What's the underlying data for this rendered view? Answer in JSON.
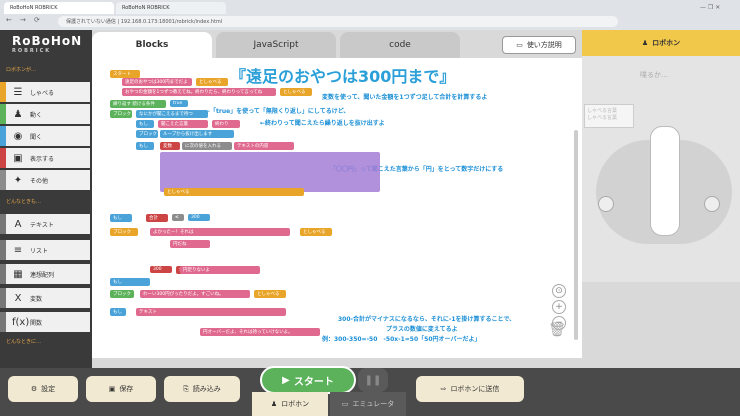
{
  "browser": {
    "tabs": [
      "RoBoHoN ROBRICK",
      "RoBoHoN ROBRICK"
    ],
    "url": "保護されていない通信 | 192.168.0.173:18001/robrick/index.html"
  },
  "app": {
    "logo": "RoBoHoN",
    "logo_sub": "ROBRICK"
  },
  "sidebar": {
    "section1": "ロボホンが…",
    "items": [
      {
        "label": "しゃべる",
        "icon": "speech-icon"
      },
      {
        "label": "動く",
        "icon": "robot-icon"
      },
      {
        "label": "聞く",
        "icon": "ear-icon"
      },
      {
        "label": "表示する",
        "icon": "display-icon"
      },
      {
        "label": "その他",
        "icon": "other-icon"
      }
    ],
    "section2": "どんなときも…",
    "items2": [
      {
        "label": "テキスト",
        "icon": "text-icon",
        "glyph": "A"
      },
      {
        "label": "リスト",
        "icon": "list-icon",
        "glyph": "≡"
      },
      {
        "label": "連想配列",
        "icon": "table-icon",
        "glyph": "▦"
      },
      {
        "label": "変数",
        "icon": "variable-icon",
        "glyph": "X"
      },
      {
        "label": "関数",
        "icon": "function-icon",
        "glyph": "f(x)"
      }
    ],
    "section3": "どんなときに…"
  },
  "tabs": {
    "blocks": "Blocks",
    "javascript": "JavaScript",
    "code": "code",
    "help": "使い方説明"
  },
  "workspace": {
    "title": "『遠足のおやつは300円まで』",
    "note1": "変数を使って、聞いた金額を1つずつ足して合計を計算するよ",
    "note2": "←「true」を使って「無限くり返し」にしてるけど、",
    "note3": "←終わりって聞こえたら繰り返しを抜け出すよ",
    "note4": "「〇〇円」って聞こえた言葉から「円」をとって数字だけにする",
    "note5": "300-合計がマイナスになるなら、それに-1を掛け算することで、",
    "note6": "プラスの数値に変えてるよ",
    "note7": "例：300-350=-50　-50x-1=50「50円オーバーだよ」",
    "blocks": [
      "スタート",
      "遠足のおやつは300円までだよ",
      "としゃべる",
      "おやつの金額を1つずつ教えてね。終わりたら、終わりって言ってね",
      "としゃべる",
      "繰り返す 続ける条件",
      "true",
      "ブロック",
      "なにかが聞こえるまで待つ",
      "もし",
      "聞こえた言葉",
      "終わり",
      "ブロック",
      "ループから抜け出します",
      "もし",
      "変数",
      "に次の値を入れる",
      "テキストの内容",
      "としゃべる",
      "もし",
      "合計",
      "≤",
      "300",
      "ブロック",
      "よかったー！それは",
      "円だね",
      "としゃべる",
      "もし",
      "300",
      "合計",
      "円足りないよ",
      "ブロック",
      "わーい300円ぴったりだよ。すごいね。",
      "としゃべる",
      "もし",
      "テキスト",
      "円オーバーだよ、それは持っていけないよ。"
    ]
  },
  "right": {
    "header": "ロボホン",
    "label": "喋るか…",
    "speech1": "しゃべる言葉",
    "speech2": "しゃべる言葉"
  },
  "bottom": {
    "settings": "設定",
    "save": "保存",
    "load": "読み込み",
    "start": "スタート",
    "robot": "ロボホン",
    "emulator": "エミュレータ",
    "send": "ロボホンに送信"
  }
}
